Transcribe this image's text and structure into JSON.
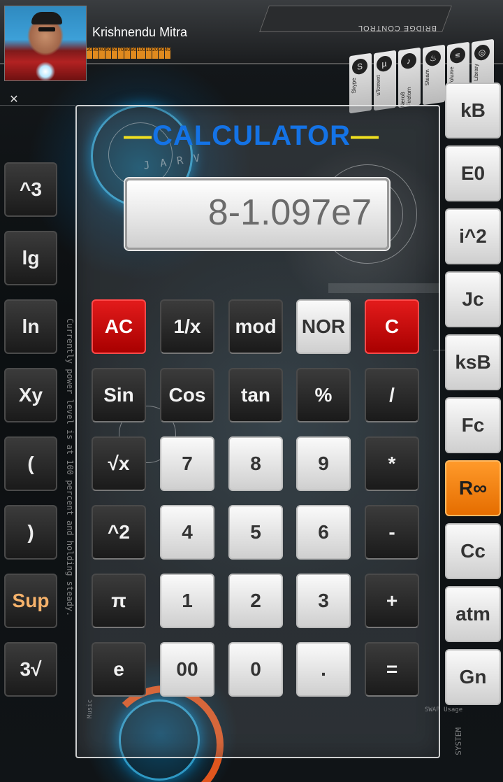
{
  "profile": {
    "name": "Krishnendu Mitra",
    "meter": [
      "20",
      "30",
      "40",
      "50",
      "60",
      "70",
      "80",
      "90",
      "100",
      "10",
      "20",
      "30",
      "40"
    ]
  },
  "header": {
    "bridge_label": "BRIDGE CONTROL"
  },
  "tray": [
    {
      "label": "Skype",
      "icon": "S"
    },
    {
      "label": "uTorrent",
      "icon": "µ"
    },
    {
      "label": "Nero8 Fireforn",
      "icon": "♪"
    },
    {
      "label": "Steam",
      "icon": "♨"
    },
    {
      "label": "Volume",
      "icon": "≡"
    },
    {
      "label": "Library",
      "icon": "◎"
    }
  ],
  "calculator": {
    "title": "CALCULATOR",
    "title_dash": "—",
    "display": "8-1.097e7",
    "rows": [
      [
        "AC",
        "1/x",
        "mod",
        "NOR",
        "C"
      ],
      [
        "Sin",
        "Cos",
        "tan",
        "%",
        "/"
      ],
      [
        "√x",
        "7",
        "8",
        "9",
        "*"
      ],
      [
        "^2",
        "4",
        "5",
        "6",
        "-"
      ],
      [
        "π",
        "1",
        "2",
        "3",
        "+"
      ],
      [
        "e",
        "00",
        "0",
        ".",
        "="
      ]
    ]
  },
  "left_keys": [
    "^3",
    "lg",
    "ln",
    "Xy",
    "(",
    ")",
    "Sup",
    "3√"
  ],
  "right_keys": [
    "kB",
    "E0",
    "i^2",
    "Jc",
    "ksB",
    "Fc",
    "R∞",
    "Cc",
    "atm",
    "Gn"
  ],
  "hud_text": [
    "Currently power level is at 100 percent and holding steady.",
    "J A R V",
    "SYSTEM",
    "Music",
    "SWAP Usage"
  ],
  "colors": {
    "title": "#1473e6",
    "title_dash": "#f0e020",
    "red": "#c40000",
    "orange": "#ff8a00"
  }
}
